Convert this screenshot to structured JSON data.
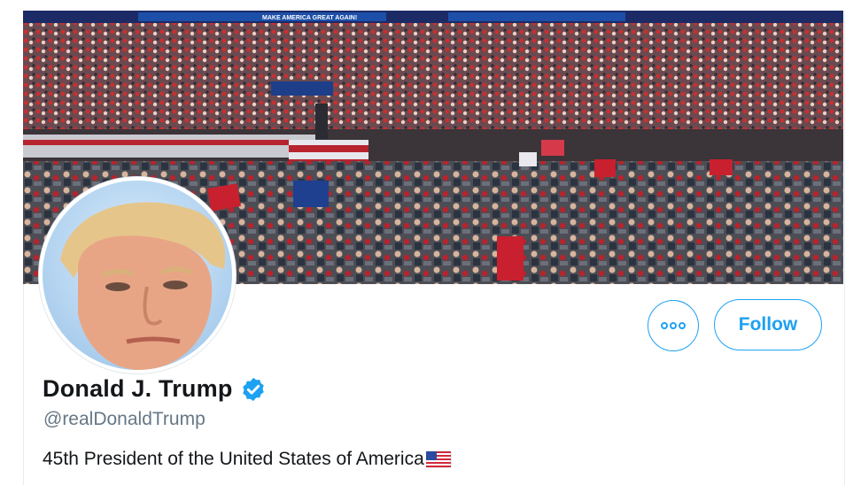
{
  "profile": {
    "display_name": "Donald J. Trump",
    "handle": "@realDonaldTrump",
    "bio": "45th President of the United States of America",
    "bio_emoji": "us-flag-icon",
    "verified": true,
    "verified_icon": "verified-badge-icon",
    "verified_color": "#1da1f2"
  },
  "banner": {
    "description": "rally crowd photo",
    "sign_text": "MAKE AMERICA GREAT AGAIN!"
  },
  "actions": {
    "more_icon": "more-options-icon",
    "follow_label": "Follow",
    "accent_color": "#1da1f2"
  }
}
